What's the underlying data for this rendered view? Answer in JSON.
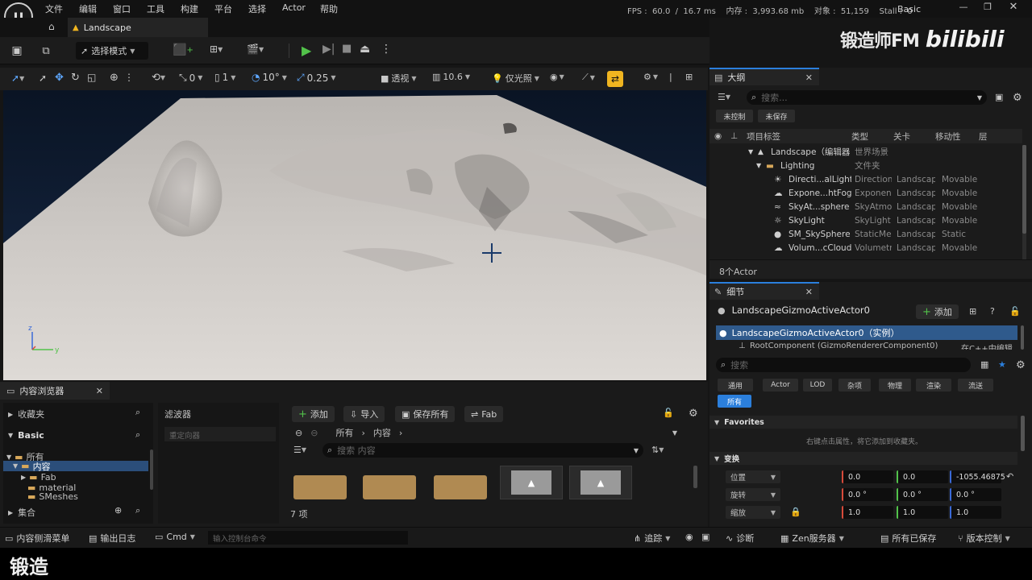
{
  "menu": [
    "文件",
    "编辑",
    "窗口",
    "工具",
    "构建",
    "平台",
    "选择",
    "Actor",
    "帮助"
  ],
  "stats": {
    "text": "FPS :  60.0  /  16.7 ms    内存 :  3,993.68 mb    对象 :  51,159    Stall :  0",
    "layout": "Basic"
  },
  "watermark": {
    "text": "锻造师FM",
    "brand": "bilibili"
  },
  "level_tab": "Landscape",
  "toolbar": {
    "mode": "选择模式"
  },
  "viewport_toolbar": {
    "snap_loc": "0",
    "snap_scale": "1",
    "rot": "10°",
    "scale": "0.25",
    "view": "透视",
    "fov": "10.6",
    "light": "仅光照"
  },
  "content_browser": {
    "tab": "内容浏览器",
    "favorites": "收藏夹",
    "basic": "Basic",
    "filters": "滤波器",
    "reset_filter": "重定向器",
    "tree": [
      "所有",
      "内容",
      "Fab",
      "material",
      "SMeshes"
    ],
    "collections": "集合",
    "add": "添加",
    "import": "导入",
    "save_all": "保存所有",
    "fab": "Fab",
    "path": [
      "所有",
      "内容"
    ],
    "search_placeholder": "搜索 内容",
    "count": "7 项"
  },
  "outliner": {
    "tab": "大纲",
    "search_placeholder": "搜索...",
    "filter_a": "未控制",
    "filter_b": "未保存",
    "columns": [
      "项目标签",
      "类型",
      "关卡",
      "移动性",
      "层"
    ],
    "root": {
      "label": "Landscape（编辑器",
      "type": "世界场景"
    },
    "folder": {
      "label": "Lighting",
      "type": "文件夹"
    },
    "items": [
      {
        "label": "Directi...alLight",
        "type": "Directiona",
        "level": "Landscap",
        "mob": "Movable"
      },
      {
        "label": "Expone...htFog",
        "type": "Exponent",
        "level": "Landscap",
        "mob": "Movable"
      },
      {
        "label": "SkyAt...sphere",
        "type": "SkyAtmos",
        "level": "Landscap",
        "mob": "Movable"
      },
      {
        "label": "SkyLight",
        "type": "SkyLight",
        "level": "Landscap",
        "mob": "Movable"
      },
      {
        "label": "SM_SkySphere",
        "type": "StaticMes",
        "level": "Landscap",
        "mob": "Static"
      },
      {
        "label": "Volum...cCloud",
        "type": "Volumetri",
        "level": "Landscap",
        "mob": "Movable"
      }
    ],
    "count": "8个Actor"
  },
  "details": {
    "tab": "细节",
    "actor": "LandscapeGizmoActiveActor0",
    "add": "添加",
    "instance": "LandscapeGizmoActiveActor0（实例）",
    "component": "RootComponent (GizmoRendererComponent0)",
    "edit_cpp": "在C++中编辑",
    "search_placeholder": "搜索",
    "filters": [
      "通用",
      "Actor",
      "LOD",
      "杂项",
      "物理",
      "渲染",
      "流送",
      "所有"
    ],
    "favorites": "Favorites",
    "fav_hint": "右键点击属性，将它添加到收藏夹。",
    "transform": "变换",
    "location": {
      "label": "位置",
      "x": "0.0",
      "y": "0.0",
      "z": "-1055.46875"
    },
    "rotation": {
      "label": "旋转",
      "x": "0.0 °",
      "y": "0.0 °",
      "z": "0.0 °"
    },
    "scale": {
      "label": "缩放",
      "x": "1.0",
      "y": "1.0",
      "z": "1.0"
    }
  },
  "statusbar": {
    "drawer": "内容侧滑菜单",
    "log": "输出日志",
    "cmd": "Cmd",
    "cmd_placeholder": "输入控制台命令",
    "trace": "追踪",
    "diag": "诊断",
    "zen": "Zen服务器",
    "saved": "所有已保存",
    "vc": "版本控制"
  },
  "subtitle": "锻造",
  "colors": {
    "accent": "#2b7fdc",
    "play": "#52c24a",
    "highlight": "#f0b520"
  }
}
